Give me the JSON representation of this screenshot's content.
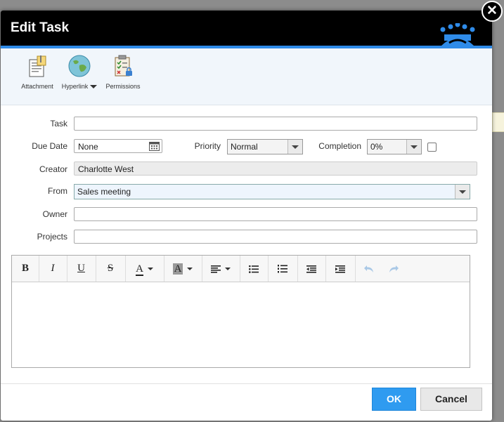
{
  "dialog": {
    "title": "Edit Task",
    "close_glyph": "✕"
  },
  "toolbar": {
    "attachment_label": "Attachment",
    "hyperlink_label": "Hyperlink",
    "permissions_label": "Permissions"
  },
  "form": {
    "task": {
      "label": "Task",
      "value": ""
    },
    "due_date": {
      "label": "Due Date",
      "value": "None"
    },
    "priority": {
      "label": "Priority",
      "value": "Normal"
    },
    "completion": {
      "label": "Completion",
      "value": "0%"
    },
    "creator": {
      "label": "Creator",
      "value": "Charlotte West"
    },
    "from": {
      "label": "From",
      "value": "Sales meeting"
    },
    "owner": {
      "label": "Owner",
      "value": ""
    },
    "projects": {
      "label": "Projects",
      "value": ""
    }
  },
  "editor": {
    "bold": "B",
    "italic": "I",
    "underline": "U",
    "strike": "S",
    "font_color": "A",
    "highlight": "A",
    "body_text": ""
  },
  "footer": {
    "ok_label": "OK",
    "cancel_label": "Cancel"
  },
  "colors": {
    "accent": "#2f8be8",
    "ok_button": "#2f9bf0",
    "title_bar": "#000000"
  }
}
